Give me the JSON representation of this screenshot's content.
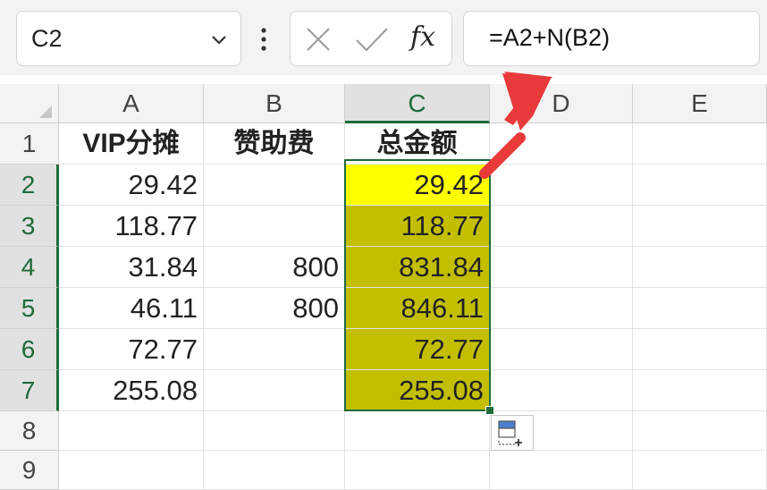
{
  "namebox": {
    "value": "C2"
  },
  "toolbar": {
    "fx_label": "fx"
  },
  "formula": {
    "value": "=A2+N(B2)"
  },
  "columns": [
    "A",
    "B",
    "C",
    "D",
    "E"
  ],
  "rows": [
    "1",
    "2",
    "3",
    "4",
    "5",
    "6",
    "7",
    "8",
    "9"
  ],
  "headers": {
    "A": "VIP分摊",
    "B": "赞助费",
    "C": "总金额"
  },
  "cells": {
    "A": [
      "29.42",
      "118.77",
      "31.84",
      "46.11",
      "72.77",
      "255.08"
    ],
    "B": [
      "",
      "",
      "800",
      "800",
      "",
      ""
    ],
    "C": [
      "29.42",
      "118.77",
      "831.84",
      "846.11",
      "72.77",
      "255.08"
    ]
  },
  "colors": {
    "active_cell": "#ffff00",
    "selection_fill": "#c3bf00",
    "selection_border": "#1e6b3a",
    "annotation_arrow": "#e83a3a"
  },
  "icons": {
    "namebox_dropdown": "chevron-down-icon",
    "more": "vertical-dots-icon",
    "cancel": "close-icon",
    "enter": "check-icon",
    "insert_function": "fx-icon",
    "quick_analysis": "quick-analysis-icon",
    "annotation": "red-arrow-icon"
  }
}
